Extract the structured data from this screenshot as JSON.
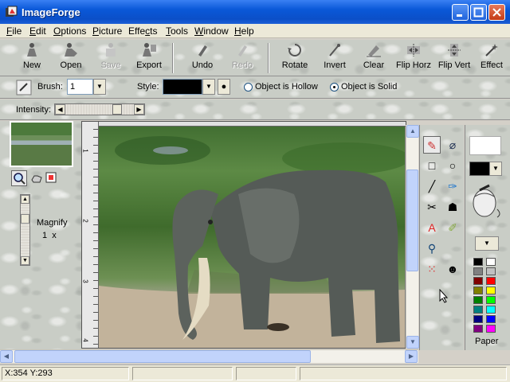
{
  "window": {
    "title": "ImageForge"
  },
  "menu": [
    {
      "label": "File",
      "key": "F"
    },
    {
      "label": "Edit",
      "key": "E"
    },
    {
      "label": "Options",
      "key": "O"
    },
    {
      "label": "Picture",
      "key": "P"
    },
    {
      "label": "Effects",
      "key": "c"
    },
    {
      "label": "Tools",
      "key": "T"
    },
    {
      "label": "Window",
      "key": "W"
    },
    {
      "label": "Help",
      "key": "H"
    }
  ],
  "toolbar": {
    "new": "New",
    "open": "Open",
    "save": "Save",
    "export": "Export",
    "undo": "Undo",
    "redo": "Redo",
    "rotate": "Rotate",
    "invert": "Invert",
    "clear": "Clear",
    "flip_horz": "Flip Horz",
    "flip_vert": "Flip Vert",
    "effect": "Effect"
  },
  "options": {
    "brush_label": "Brush:",
    "brush_value": "1",
    "style_label": "Style:",
    "style_color": "#000000",
    "hollow_label": "Object is Hollow",
    "solid_label": "Object is Solid",
    "selected": "solid"
  },
  "intensity": {
    "label": "Intensity:",
    "value_fraction": 0.8
  },
  "magnify": {
    "label": "Magnify",
    "value": "1  x"
  },
  "ruler": {
    "marks": [
      "1",
      "2",
      "3",
      "4"
    ]
  },
  "right_panel": {
    "paper_label": "Paper",
    "foreground_color": "#000000",
    "background_color": "#ffffff"
  },
  "colors": [
    "#000000",
    "#ffffff",
    "#808080",
    "#c0c0c0",
    "#800000",
    "#ff0000",
    "#808000",
    "#ffff00",
    "#008000",
    "#00ff00",
    "#008080",
    "#00ffff",
    "#000080",
    "#0000ff",
    "#800080",
    "#ff00ff"
  ],
  "status": {
    "coords": "X:354 Y:293"
  }
}
